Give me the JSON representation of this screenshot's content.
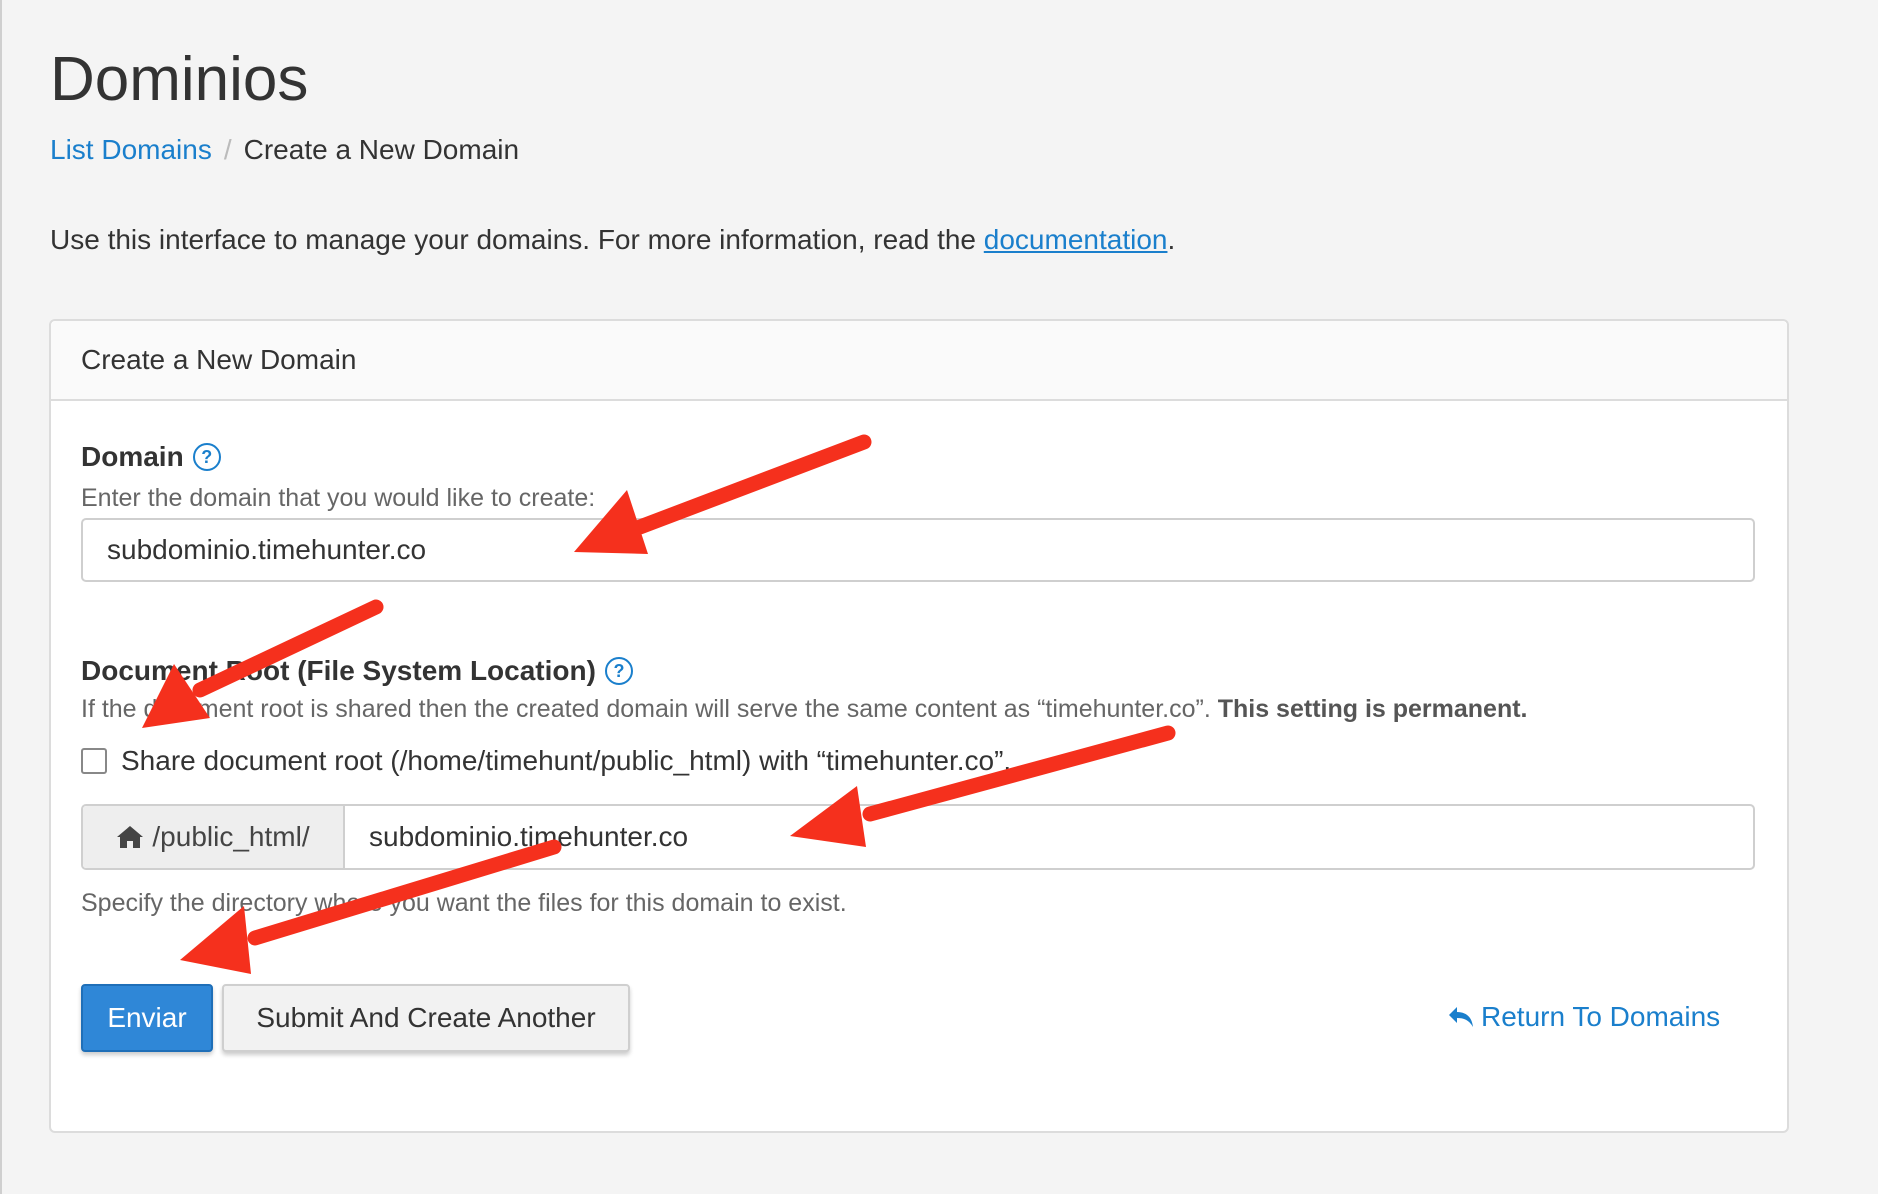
{
  "page": {
    "title": "Dominios"
  },
  "breadcrumb": {
    "link_label": "List Domains",
    "separator": "/",
    "current": "Create a New Domain"
  },
  "intro": {
    "text": "Use this interface to manage your domains. For more information, read the ",
    "link_label": "documentation",
    "suffix": "."
  },
  "panel": {
    "header": "Create a New Domain",
    "domain": {
      "label": "Domain",
      "help_icon": "question-circle-icon",
      "description": "Enter the domain that you would like to create:",
      "value": "subdominio.timehunter.co"
    },
    "document_root": {
      "label": "Document Root (File System Location)",
      "help_icon": "question-circle-icon",
      "description": "If the document root is shared then the created domain will serve the same content as “timehunter.co”. ",
      "description_bold": "This setting is permanent.",
      "share_label": "Share document root (/home/timehunt/public_html) with “timehunter.co”.",
      "share_checked": false,
      "prefix_icon": "home-icon",
      "prefix": "/public_html/",
      "value": "subdominio.timehunter.co",
      "help_text": "Specify the directory where you want the files for this domain to exist."
    },
    "buttons": {
      "submit": "Enviar",
      "submit_another": "Submit And Create Another",
      "return_icon": "reply-arrow-icon",
      "return": "Return To Domains"
    }
  },
  "colors": {
    "link": "#1a7fcc",
    "primary": "#2f87d7",
    "annotation_arrow": "#f5301d"
  }
}
